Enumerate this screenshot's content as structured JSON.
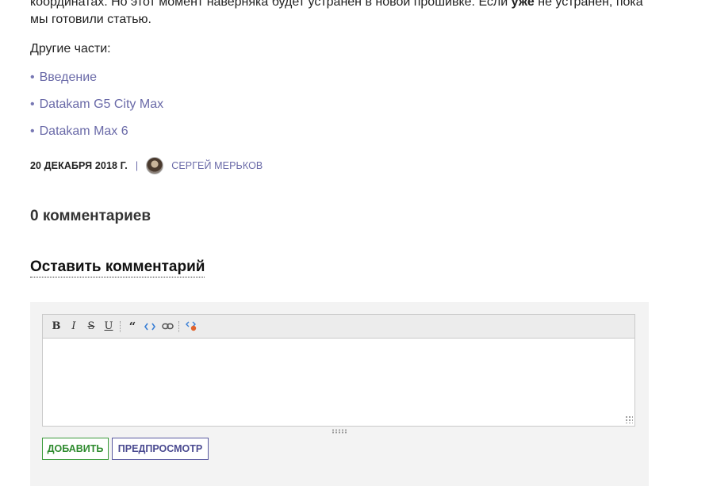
{
  "article": {
    "line1_start": "координатах. Но этот момент наверняка будет устранен в новой прошивке. Если ",
    "line1_bold": "уже",
    "line1_end": " не устранен, пока",
    "line2": "мы готовили статью."
  },
  "other_parts": {
    "label": "Другие части:",
    "bullet": "•",
    "items": [
      {
        "label": "Введение"
      },
      {
        "label": "Datakam G5 City Max"
      },
      {
        "label": "Datakam Max 6"
      }
    ]
  },
  "meta": {
    "date": "20 ДЕКАБРЯ 2018 Г.",
    "separator": "|",
    "author": "СЕРГЕЙ МЕРЬКОВ"
  },
  "comments": {
    "count_title": "0 комментариев",
    "leave_title": "Оставить комментарий"
  },
  "editor": {
    "toolbar": {
      "bold": "B",
      "italic": "I",
      "strike": "S",
      "underline": "U",
      "quote": "“"
    },
    "textarea_value": "",
    "add_label": "ДОБАВИТЬ",
    "preview_label": "ПРЕДПРОСМОТР"
  },
  "colors": {
    "link": "#6a6aa8",
    "add_button": "#2d8a2d",
    "preview_button": "#4a4a90"
  }
}
